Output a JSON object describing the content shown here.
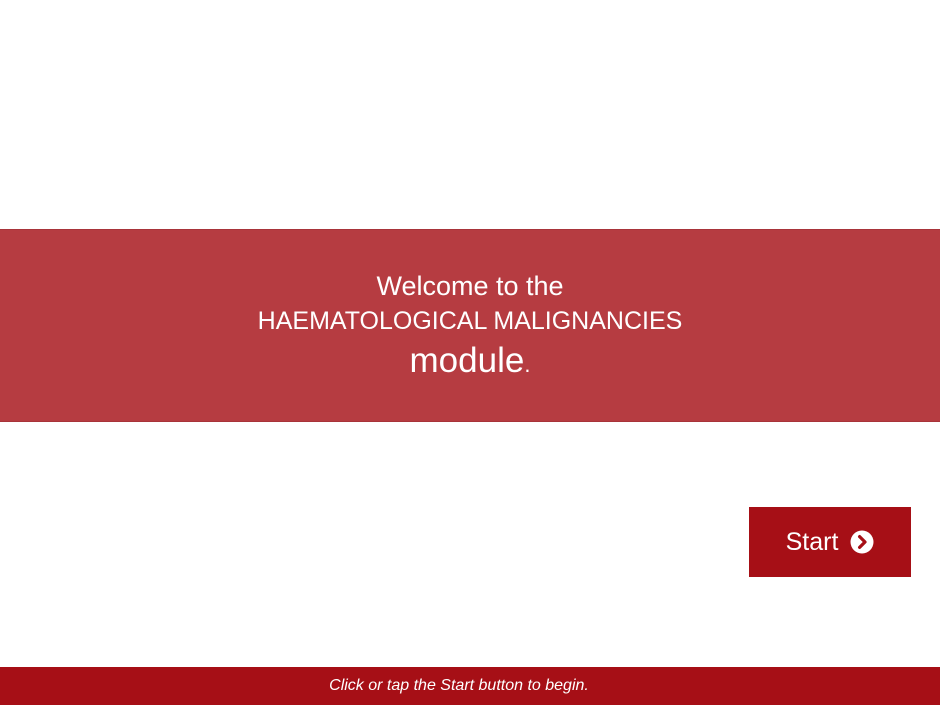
{
  "banner": {
    "welcome_text": "Welcome to the",
    "module_title": "HAEMATOLOGICAL MALIGNANCIES",
    "module_word": "module",
    "period": "."
  },
  "start_button": {
    "label": "Start",
    "icon": "chevron-right-circle-icon"
  },
  "footer": {
    "instruction": "Click or tap the Start button to begin."
  },
  "colors": {
    "banner_background": "#b63c41",
    "button_background": "#a60f16",
    "footer_background": "#a60f16",
    "text": "#ffffff",
    "page_background": "#ffffff"
  }
}
